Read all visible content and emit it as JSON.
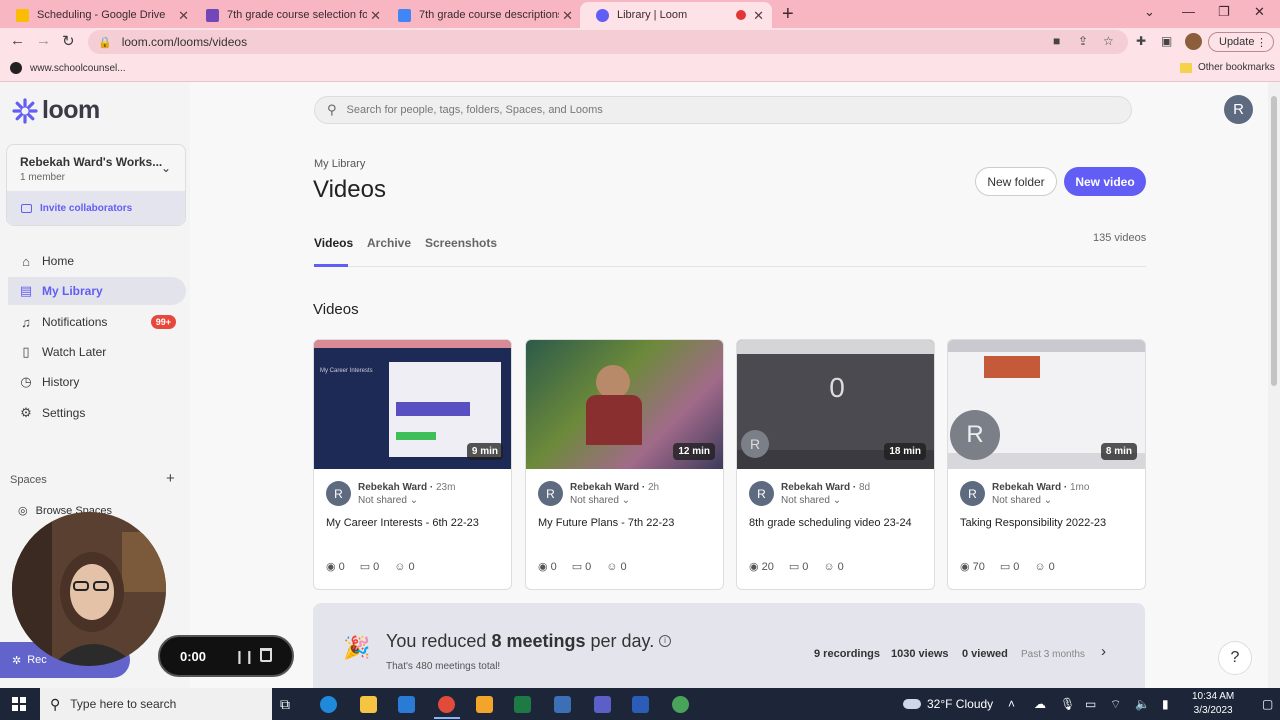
{
  "browser": {
    "tabs": [
      {
        "title": "Scheduling - Google Drive",
        "favicon_color": "#fbbc04"
      },
      {
        "title": "7th grade course selection form",
        "favicon_color": "#7248b9"
      },
      {
        "title": "7th grade course descriptions",
        "favicon_color": "#4285f4"
      },
      {
        "title": "Library | Loom",
        "favicon_color": "#625df5"
      }
    ],
    "url": "loom.com/looms/videos",
    "update_label": "Update",
    "bookmarks": {
      "left": "www.schoolcounsel...",
      "right": "Other bookmarks"
    }
  },
  "sidebar": {
    "logo_text": "loom",
    "workspace_name": "Rebekah Ward's Works...",
    "workspace_members": "1 member",
    "invite_label": "Invite collaborators",
    "nav": [
      {
        "label": "Home",
        "icon": "house-icon"
      },
      {
        "label": "My Library",
        "icon": "library-icon"
      },
      {
        "label": "Notifications",
        "icon": "bell-icon",
        "badge": "99+"
      },
      {
        "label": "Watch Later",
        "icon": "bookmark-icon"
      },
      {
        "label": "History",
        "icon": "clock-icon"
      },
      {
        "label": "Settings",
        "icon": "gear-icon"
      }
    ],
    "spaces_heading": "Spaces",
    "browse_spaces": "Browse Spaces"
  },
  "main": {
    "search_placeholder": "Search for people, tags, folders, Spaces, and Looms",
    "avatar_initial": "R",
    "subheading": "My Library",
    "title": "Videos",
    "new_folder": "New folder",
    "new_video": "New video",
    "tabs": [
      "Videos",
      "Archive",
      "Screenshots"
    ],
    "video_count": "135 videos",
    "section_title": "Videos",
    "cards": [
      {
        "duration": "9 min",
        "owner": "Rebekah Ward",
        "time": "23m",
        "share": "Not shared",
        "title": "My Career Interests - 6th 22-23",
        "views": "0",
        "comments": "0",
        "reactions": "0"
      },
      {
        "duration": "12 min",
        "owner": "Rebekah Ward",
        "time": "2h",
        "share": "Not shared",
        "title": "My Future Plans - 7th 22-23",
        "views": "0",
        "comments": "0",
        "reactions": "0"
      },
      {
        "duration": "18 min",
        "owner": "Rebekah Ward",
        "time": "8d",
        "share": "Not shared",
        "title": "8th grade scheduling video 23-24",
        "views": "20",
        "comments": "0",
        "reactions": "0"
      },
      {
        "duration": "8 min",
        "owner": "Rebekah Ward",
        "time": "1mo",
        "share": "Not shared",
        "title": "Taking Responsibility 2022-23",
        "views": "70",
        "comments": "0",
        "reactions": "0"
      }
    ],
    "banner": {
      "heading_pre": "You reduced ",
      "heading_bold": "8 meetings",
      "heading_post": " per day.",
      "sub": "That's 480 meetings total!",
      "recordings": "9 recordings",
      "views": "1030 views",
      "viewed": "0 viewed",
      "period": "Past 3 months"
    }
  },
  "recorder": {
    "time": "0:00",
    "pill_label": "Rec"
  },
  "taskbar": {
    "search_placeholder": "Type here to search",
    "weather": "32°F  Cloudy",
    "time": "10:34 AM",
    "date": "3/3/2023"
  },
  "colors": {
    "accent": "#625df5",
    "badge": "#e8473b",
    "chrome_tab": "#f7b6c1"
  }
}
